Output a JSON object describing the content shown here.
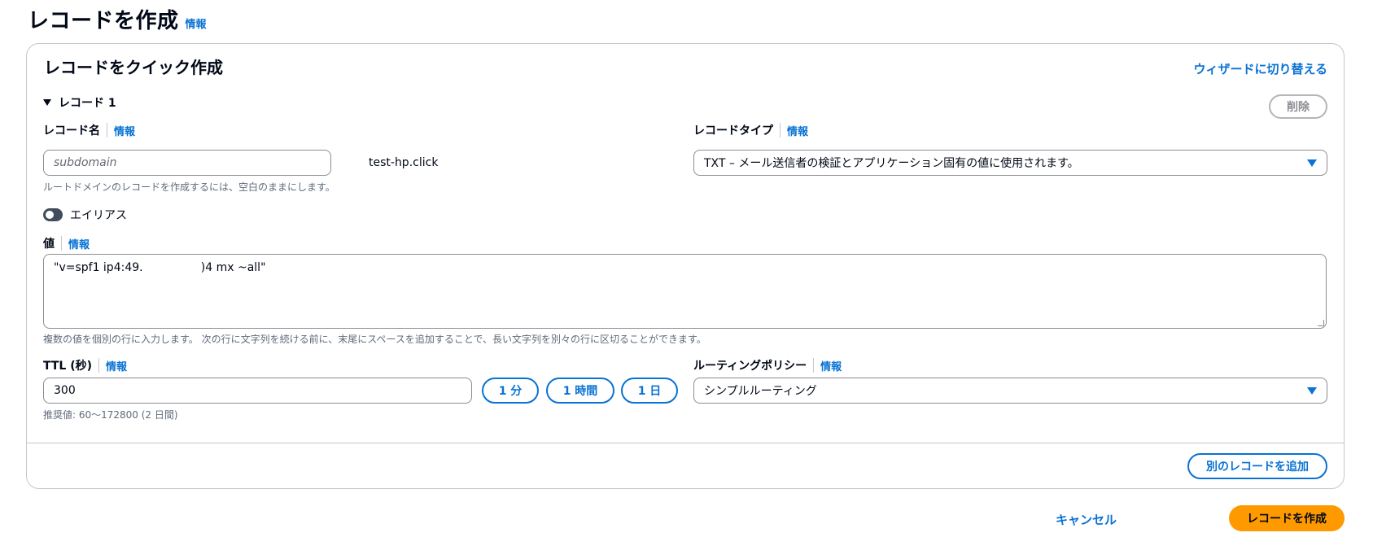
{
  "page": {
    "title": "レコードを作成",
    "info": "情報"
  },
  "card": {
    "title": "レコードをクイック作成",
    "wizard_link": "ウィザードに切り替える",
    "record_label": "レコード 1",
    "delete_label": "削除",
    "record_name": {
      "label": "レコード名",
      "info": "情報",
      "placeholder": "subdomain",
      "domain_suffix": "test-hp.click",
      "hint": "ルートドメインのレコードを作成するには、空白のままにします。"
    },
    "record_type": {
      "label": "レコードタイプ",
      "info": "情報",
      "selected": "TXT – メール送信者の検証とアプリケーション固有の値に使用されます。"
    },
    "alias": {
      "label": "エイリアス"
    },
    "value": {
      "label": "値",
      "info": "情報",
      "text": "\"v=spf1 ip4:49.                )4 mx ~all\"",
      "hint": "複数の値を個別の行に入力します。 次の行に文字列を続ける前に、末尾にスペースを追加することで、長い文字列を別々の行に区切ることができます。"
    },
    "ttl": {
      "label": "TTL (秒)",
      "info": "情報",
      "value": "300",
      "btn_1m": "1 分",
      "btn_1h": "1 時間",
      "btn_1d": "1 日",
      "hint": "推奨値: 60～172800 (2 日間)"
    },
    "routing": {
      "label": "ルーティングポリシー",
      "info": "情報",
      "selected": "シンプルルーティング"
    },
    "add_record": "別のレコードを追加"
  },
  "footer": {
    "cancel": "キャンセル",
    "create": "レコードを作成"
  },
  "colors": {
    "link": "#0972d3",
    "primary": "#ff9900",
    "border": "#c6c6cd"
  }
}
